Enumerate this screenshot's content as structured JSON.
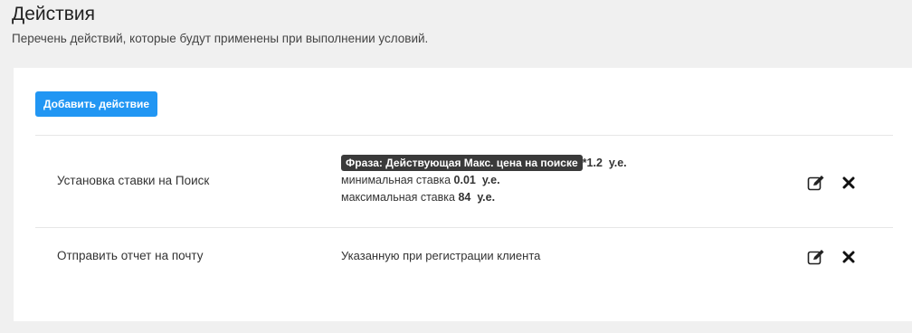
{
  "header": {
    "title": "Действия",
    "subtitle": "Перечень действий, которые будут применены при выполнении условий."
  },
  "toolbar": {
    "add_label": "Добавить действие"
  },
  "actions": [
    {
      "name": "Установка ставки на Поиск",
      "tag": "Фраза: Действующая Макс. цена на поиске",
      "multiplier": "*1.2",
      "multiplier_unit": "у.е.",
      "min_label": "минимальная ставка",
      "min_value": "0.01",
      "min_unit": "у.е.",
      "max_label": "максимальная ставка",
      "max_value": "84",
      "max_unit": "у.е."
    },
    {
      "name": "Отправить отчет на почту",
      "description": "Указанную при регистрации клиента"
    }
  ],
  "icons": {
    "edit": "edit-icon",
    "delete": "delete-icon"
  }
}
